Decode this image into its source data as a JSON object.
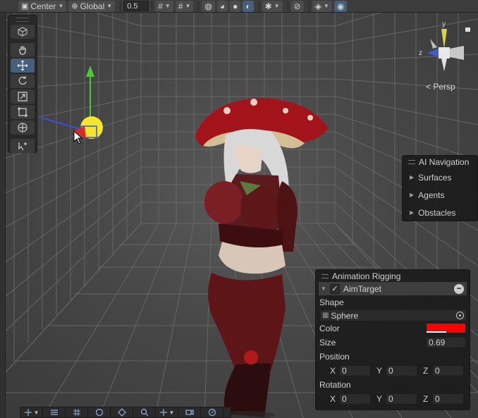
{
  "toolbar": {
    "pivot_mode": "Center",
    "pivot_rotation": "Global",
    "grid_snap_value": "0.5"
  },
  "tool_palette": {
    "tools": [
      "view-tool",
      "move-tool",
      "rotate-tool",
      "scale-tool",
      "rect-tool",
      "transform-tool",
      "custom-tool"
    ],
    "active_tool": "move-tool"
  },
  "gizmo": {
    "view_label": "< Persp",
    "axis_z_label": "z",
    "axis_y_label": "y"
  },
  "ai_navigation": {
    "title": "AI Navigation",
    "items": [
      {
        "label": "Surfaces"
      },
      {
        "label": "Agents"
      },
      {
        "label": "Obstacles"
      }
    ]
  },
  "animation_rigging": {
    "title": "Animation Rigging",
    "component": "AimTarget",
    "shape_label": "Shape",
    "shape_value": "Sphere",
    "color_label": "Color",
    "color_value": "#ff0000",
    "size_label": "Size",
    "size_value": "0.69",
    "position_label": "Position",
    "position": {
      "x": "0",
      "y": "0",
      "z": "0"
    },
    "rotation_label": "Rotation",
    "rotation": {
      "x": "0",
      "y": "0",
      "z": "0"
    },
    "axis_x": "X",
    "axis_y": "Y",
    "axis_z": "Z"
  },
  "colors": {
    "accent": "#46607c",
    "panel_bg": "#1c1c1c",
    "viewport_bg": "#474747"
  }
}
